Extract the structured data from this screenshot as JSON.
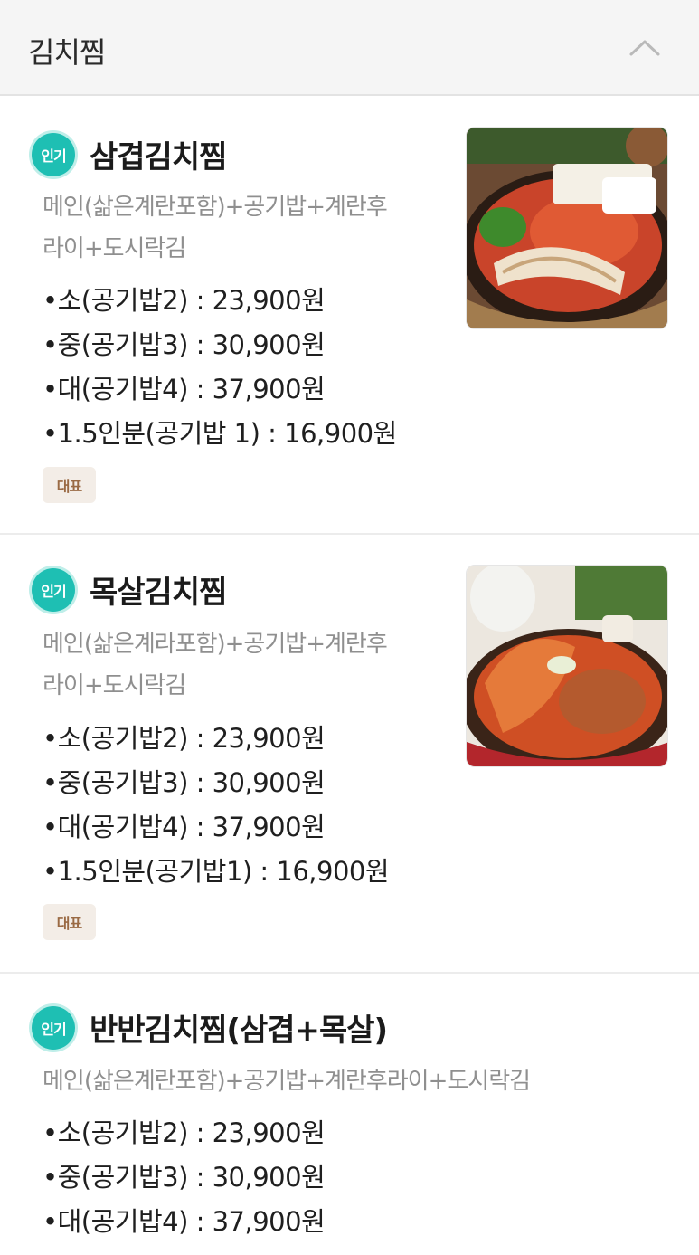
{
  "section": {
    "title": "김치찜",
    "collapse_icon": "chevron-up-icon"
  },
  "items": [
    {
      "badge": "인기",
      "name": "삼겹김치찜",
      "description_lines": [
        "메인(삶은계란포함)+공기밥+계란후",
        "라이+도시락김"
      ],
      "prices": [
        "•소(공기밥2) : 23,900원",
        "•중(공기밥3) : 30,900원",
        "•대(공기밥4) : 37,900원",
        "•1.5인분(공기밥 1) : 16,900원"
      ],
      "tag": "대표",
      "photo": "samgyeop-kimchi-jjim-photo"
    },
    {
      "badge": "인기",
      "name": "목살김치찜",
      "description_lines": [
        "메인(삶은계라포함)+공기밥+계란후",
        "라이+도시락김"
      ],
      "prices": [
        "•소(공기밥2) : 23,900원",
        "•중(공기밥3) : 30,900원",
        "•대(공기밥4) : 37,900원",
        "•1.5인분(공기밥1) : 16,900원"
      ],
      "tag": "대표",
      "photo": "moksal-kimchi-jjim-photo"
    },
    {
      "badge": "인기",
      "name": "반반김치찜(삼겹+목살)",
      "description_lines": [
        "메인(삶은계란포함)+공기밥+계란후라이+도시락김"
      ],
      "prices": [
        "•소(공기밥2) : 23,900원",
        "•중(공기밥3) : 30,900원",
        "•대(공기밥4) : 37,900원"
      ]
    }
  ],
  "colors": {
    "badge": "#1ebfb3",
    "tag_bg": "#f3ede7",
    "tag_text": "#9a6a44",
    "header_bg": "#f5f5f5"
  }
}
